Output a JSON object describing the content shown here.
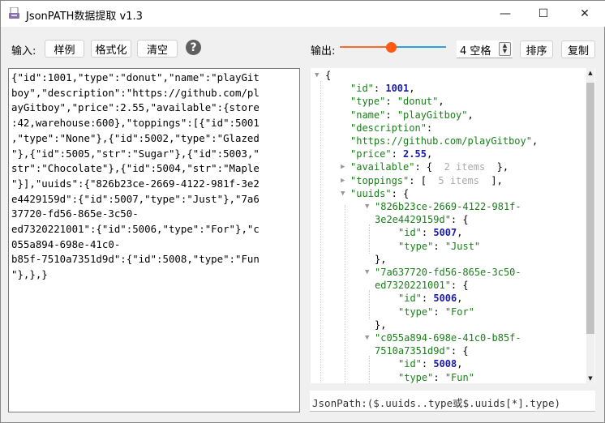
{
  "window": {
    "title": "JsonPATH数据提取 v1.3",
    "minimize": "—",
    "maximize": "☐",
    "close": "✕"
  },
  "input": {
    "label": "输入:",
    "buttons": {
      "sample": "样例",
      "format": "格式化",
      "clear": "清空"
    },
    "help": "?",
    "lines": [
      "{\"id\":1001,\"type\":\"donut\",\"name\":\"playGit",
      "boy\",\"description\":\"https://github.com/pl",
      "ayGitboy\",\"price\":2.55,\"available\":{store",
      ":42,warehouse:600},\"toppings\":[{\"id\":5001",
      ",\"type\":\"None\"},{\"id\":5002,\"type\":\"Glazed",
      "\"},{\"id\":5005,\"str\":\"Sugar\"},{\"id\":5003,\"",
      "str\":\"Chocolate\"},{\"id\":5004,\"str\":\"Maple",
      "\"}],\"uuids\":{\"826b23ce-2669-4122-981f-3e2",
      "e4429159d\":{\"id\":5007,\"type\":\"Just\"},\"7a6",
      "37720-fd56-865e-3c50-",
      "ed7320221001\":{\"id\":5006,\"type\":\"For\"},\"c",
      "055a894-698e-41c0-",
      "b85f-7510a7351d9d\":{\"id\":5008,\"type\":\"Fun",
      "\"},},}"
    ]
  },
  "output": {
    "label": "输出:",
    "indent_slider_value": 0.48,
    "indent_select": "4 空格",
    "buttons": {
      "sort": "排序",
      "copy": "复制"
    },
    "colors": {
      "key": "#1a7f1a",
      "number": "#1a1ab0",
      "slider_left": "#ff6a2b",
      "slider_right": "#29a3e0"
    },
    "tree": [
      {
        "lvl": 0,
        "tog": "open",
        "parts": [
          [
            "{",
            "p"
          ]
        ]
      },
      {
        "lvl": 1,
        "parts": [
          [
            "\"id\"",
            "k"
          ],
          [
            ": ",
            "p"
          ],
          [
            "1001",
            "n"
          ],
          [
            ",",
            "p"
          ]
        ]
      },
      {
        "lvl": 1,
        "parts": [
          [
            "\"type\"",
            "k"
          ],
          [
            ": ",
            "p"
          ],
          [
            "\"donut\"",
            "s"
          ],
          [
            ",",
            "p"
          ]
        ]
      },
      {
        "lvl": 1,
        "parts": [
          [
            "\"name\"",
            "k"
          ],
          [
            ": ",
            "p"
          ],
          [
            "\"playGitboy\"",
            "s"
          ],
          [
            ",",
            "p"
          ]
        ]
      },
      {
        "lvl": 1,
        "parts": [
          [
            "\"description\"",
            "k"
          ],
          [
            ":",
            "p"
          ]
        ]
      },
      {
        "lvl": 1,
        "parts": [
          [
            "\"https://github.com/playGitboy\"",
            "s"
          ],
          [
            ",",
            "p"
          ]
        ]
      },
      {
        "lvl": 1,
        "parts": [
          [
            "\"price\"",
            "k"
          ],
          [
            ": ",
            "p"
          ],
          [
            "2.55",
            "n"
          ],
          [
            ",",
            "p"
          ]
        ]
      },
      {
        "lvl": 1,
        "tog": "closed",
        "parts": [
          [
            "\"available\"",
            "k"
          ],
          [
            ": {  ",
            "p"
          ],
          [
            "2 items",
            "g"
          ],
          [
            "  },",
            "p"
          ]
        ]
      },
      {
        "lvl": 1,
        "tog": "closed",
        "parts": [
          [
            "\"toppings\"",
            "k"
          ],
          [
            ": [  ",
            "p"
          ],
          [
            "5 items",
            "g"
          ],
          [
            "  ],",
            "p"
          ]
        ]
      },
      {
        "lvl": 1,
        "tog": "open",
        "parts": [
          [
            "\"uuids\"",
            "k"
          ],
          [
            ": {",
            "p"
          ]
        ]
      },
      {
        "lvl": 2,
        "tog": "open",
        "parts": [
          [
            "\"826b23ce-2669-4122-981f-",
            "k"
          ]
        ]
      },
      {
        "lvl": 2,
        "parts": [
          [
            "3e2e4429159d\"",
            "k"
          ],
          [
            ": {",
            "p"
          ]
        ]
      },
      {
        "lvl": 3,
        "parts": [
          [
            "\"id\"",
            "k"
          ],
          [
            ": ",
            "p"
          ],
          [
            "5007",
            "n"
          ],
          [
            ",",
            "p"
          ]
        ]
      },
      {
        "lvl": 3,
        "parts": [
          [
            "\"type\"",
            "k"
          ],
          [
            ": ",
            "p"
          ],
          [
            "\"Just\"",
            "s"
          ]
        ]
      },
      {
        "lvl": 2,
        "parts": [
          [
            "},",
            "p"
          ]
        ]
      },
      {
        "lvl": 2,
        "tog": "open",
        "parts": [
          [
            "\"7a637720-fd56-865e-3c50-",
            "k"
          ]
        ]
      },
      {
        "lvl": 2,
        "parts": [
          [
            "ed7320221001\"",
            "k"
          ],
          [
            ": {",
            "p"
          ]
        ]
      },
      {
        "lvl": 3,
        "parts": [
          [
            "\"id\"",
            "k"
          ],
          [
            ": ",
            "p"
          ],
          [
            "5006",
            "n"
          ],
          [
            ",",
            "p"
          ]
        ]
      },
      {
        "lvl": 3,
        "parts": [
          [
            "\"type\"",
            "k"
          ],
          [
            ": ",
            "p"
          ],
          [
            "\"For\"",
            "s"
          ]
        ]
      },
      {
        "lvl": 2,
        "parts": [
          [
            "},",
            "p"
          ]
        ]
      },
      {
        "lvl": 2,
        "tog": "open",
        "parts": [
          [
            "\"c055a894-698e-41c0-b85f-",
            "k"
          ]
        ]
      },
      {
        "lvl": 2,
        "parts": [
          [
            "7510a7351d9d\"",
            "k"
          ],
          [
            ": {",
            "p"
          ]
        ]
      },
      {
        "lvl": 3,
        "parts": [
          [
            "\"id\"",
            "k"
          ],
          [
            ": ",
            "p"
          ],
          [
            "5008",
            "n"
          ],
          [
            ",",
            "p"
          ]
        ]
      },
      {
        "lvl": 3,
        "parts": [
          [
            "\"type\"",
            "k"
          ],
          [
            ": ",
            "p"
          ],
          [
            "\"Fun\"",
            "s"
          ]
        ]
      }
    ],
    "jsonpath_value": "JsonPath:($.uuids..type或$.uuids[*].type)"
  }
}
